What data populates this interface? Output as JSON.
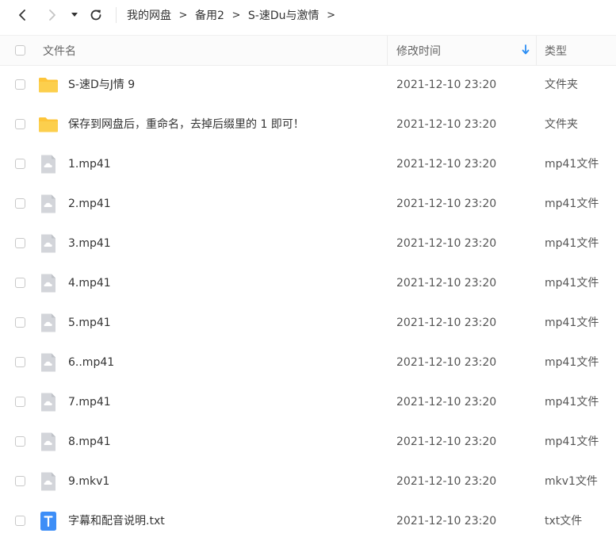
{
  "breadcrumb": [
    "我的网盘",
    "备用2",
    "S-速Du与激情"
  ],
  "breadcrumb_separator": ">",
  "columns": {
    "name": "文件名",
    "time": "修改时间",
    "type": "类型"
  },
  "colors": {
    "accent": "#2b8ef4",
    "folder": "#fdc53a",
    "file_icon": "#d3d5da",
    "txt_icon": "#3d8ef7"
  },
  "files": [
    {
      "icon": "folder-icon",
      "name": "S-速D与J情 9",
      "time": "2021-12-10 23:20",
      "type": "文件夹"
    },
    {
      "icon": "folder-icon",
      "name": "保存到网盘后，重命名，去掉后缀里的 1  即可！",
      "time": "2021-12-10 23:20",
      "type": "文件夹"
    },
    {
      "icon": "file-icon",
      "name": "1.mp41",
      "time": "2021-12-10 23:20",
      "type": "mp41文件"
    },
    {
      "icon": "file-icon",
      "name": "2.mp41",
      "time": "2021-12-10 23:20",
      "type": "mp41文件"
    },
    {
      "icon": "file-icon",
      "name": "3.mp41",
      "time": "2021-12-10 23:20",
      "type": "mp41文件"
    },
    {
      "icon": "file-icon",
      "name": "4.mp41",
      "time": "2021-12-10 23:20",
      "type": "mp41文件"
    },
    {
      "icon": "file-icon",
      "name": "5.mp41",
      "time": "2021-12-10 23:20",
      "type": "mp41文件"
    },
    {
      "icon": "file-icon",
      "name": "6..mp41",
      "time": "2021-12-10 23:20",
      "type": "mp41文件"
    },
    {
      "icon": "file-icon",
      "name": "7.mp41",
      "time": "2021-12-10 23:20",
      "type": "mp41文件"
    },
    {
      "icon": "file-icon",
      "name": "8.mp41",
      "time": "2021-12-10 23:20",
      "type": "mp41文件"
    },
    {
      "icon": "file-icon",
      "name": "9.mkv1",
      "time": "2021-12-10 23:20",
      "type": "mkv1文件"
    },
    {
      "icon": "txt-file-icon",
      "name": "字幕和配音说明.txt",
      "time": "2021-12-10 23:20",
      "type": "txt文件"
    }
  ]
}
